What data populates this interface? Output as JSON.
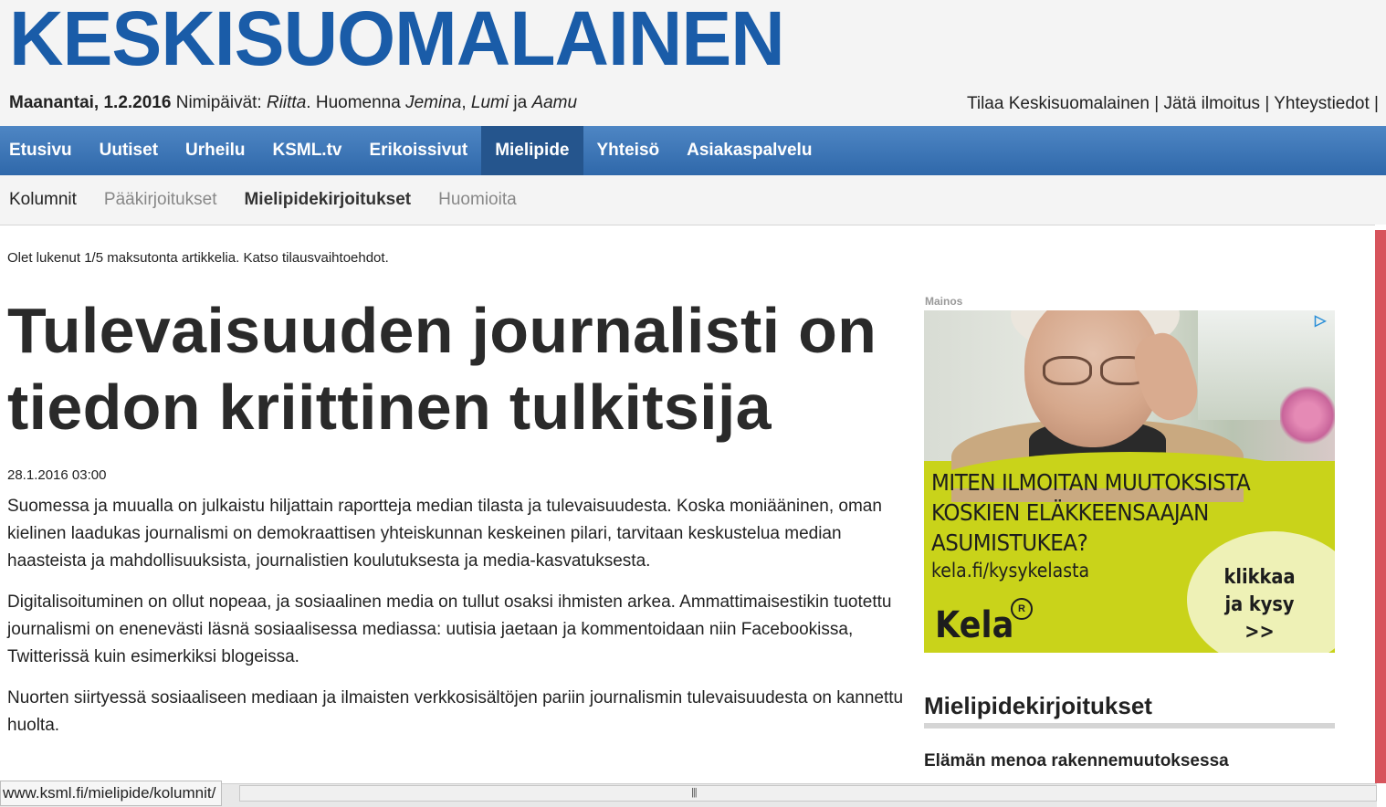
{
  "masthead": {
    "logo": "KESKISUOMALAINEN",
    "date": "Maanantai, 1.2.2016",
    "nameday_label": "Nimipäivät:",
    "nameday_today": "Riitta",
    "tomorrow_label": "Huomenna",
    "tomorrow_name1": "Jemina",
    "tomorrow_name2": "Lumi",
    "and_word": "ja",
    "tomorrow_name3": "Aamu",
    "links": [
      "Tilaa Keskisuomalainen",
      "Jätä ilmoitus",
      "Yhteystiedot"
    ]
  },
  "main_nav": [
    "Etusivu",
    "Uutiset",
    "Urheilu",
    "KSML.tv",
    "Erikoissivut",
    "Mielipide",
    "Yhteisö",
    "Asiakaspalvelu"
  ],
  "main_nav_active": "Mielipide",
  "sub_nav": [
    "Kolumnit",
    "Pääkirjoitukset",
    "Mielipidekirjoitukset",
    "Huomioita"
  ],
  "article": {
    "paywall_notice": "Olet lukenut 1/5 maksutonta artikkelia. Katso tilausvaihtoehdot.",
    "headline": "Tulevaisuuden journalisti on tiedon kriittinen tulkitsija",
    "pubdate": "28.1.2016 03:00",
    "paragraphs": [
      "Suomessa ja muualla on julkaistu hiljattain raportteja median tilasta ja tulevaisuudesta. Koska moniääninen, oman kielinen laadukas journalismi on demokraattisen yhteiskunnan keskeinen pilari, tarvitaan keskustelua median haasteista ja mahdollisuuksista, journalistien koulutuksesta ja media-kasvatuksesta.",
      "Digitalisoituminen on ollut nopeaa, ja sosiaalinen media on tullut osaksi ihmisten arkea. Ammattimaisestikin tuotettu journalismi on enenevästi läsnä sosiaalisessa mediassa: uutisia jaetaan ja kommentoidaan niin Facebookissa, Twitterissä kuin esimerkiksi blogeissa.",
      "Nuorten siirtyessä sosiaaliseen mediaan ja ilmaisten verkkosisältöjen pariin journalismin tulevaisuudesta on kannettu huolta."
    ]
  },
  "ad": {
    "label": "Mainos",
    "line1": "MITEN ILMOITAN MUUTOKSISTA",
    "line2": "KOSKIEN ELÄKKEENSAAJAN",
    "line3": "ASUMISTUKEA?",
    "url": "kela.fi/kysykelasta",
    "brand": "Kela",
    "cta1": "klikkaa",
    "cta2": "ja kysy",
    "cta3": ">>"
  },
  "sidebar": {
    "heading": "Mielipidekirjoitukset",
    "first_item": "Elämän menoa rakennemuutoksessa"
  },
  "statusbar": {
    "url": "www.ksml.fi/mielipide/kolumnit/"
  },
  "colors": {
    "brand_blue": "#1a5ca8",
    "nav_blue": "#3a74b6",
    "ad_green": "#c9d31a"
  }
}
